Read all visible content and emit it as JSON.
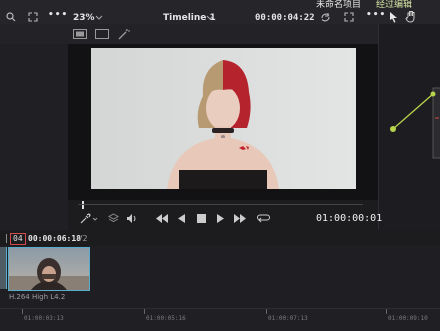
{
  "toolbar": {
    "zoom": "23%",
    "timeline_name": "Timeline 1",
    "source_timecode": "00:00:04:22",
    "project_title": "未命名项目",
    "edit_label": "经过编辑"
  },
  "transport": {
    "timecode": "01:00:00:01"
  },
  "timeline": {
    "track_label": "04",
    "clip_timecode": "00:00:06:18",
    "track_name": "V2",
    "clip_codec": "H.264 High L4.2"
  },
  "ruler": {
    "ticks": [
      "01:00:03:13",
      "01:00:05:16",
      "01:00:07:13",
      "01:00:09:10"
    ]
  },
  "colors": {
    "accent_clip_border": "#58aeca",
    "node_green": "#b7d44a",
    "background": "#1c1c1f"
  }
}
